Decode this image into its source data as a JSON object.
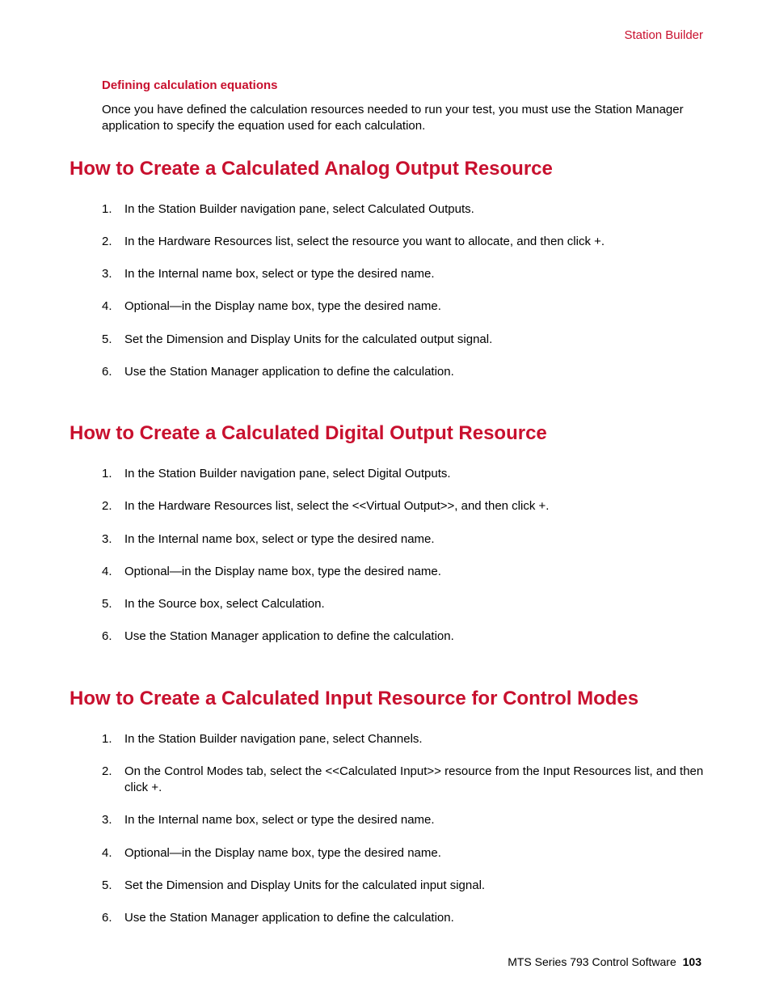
{
  "header": {
    "section_label": "Station Builder"
  },
  "intro": {
    "subheading": "Defining calculation equations",
    "body": "Once you have defined the calculation resources needed to run your test, you must use the Station Manager application to specify the equation used for each calculation."
  },
  "sections": [
    {
      "title": "How to Create a Calculated Analog Output Resource",
      "steps": [
        "In the Station Builder navigation pane, select Calculated Outputs.",
        "In the Hardware Resources list, select the resource you want to allocate, and then click +.",
        "In the Internal name box, select or type the desired name.",
        "Optional—in the Display name box, type the desired name.",
        "Set the Dimension and Display Units for the calculated output signal.",
        "Use the Station Manager application to define the calculation."
      ]
    },
    {
      "title": "How to Create a Calculated Digital Output Resource",
      "steps": [
        "In the Station Builder navigation pane, select Digital Outputs.",
        "In the Hardware Resources list, select the <<Virtual Output>>, and then click +.",
        "In the Internal name box, select or type the desired name.",
        "Optional—in the Display name box, type the desired name.",
        "In the Source box, select Calculation.",
        "Use the Station Manager application to define the calculation."
      ]
    },
    {
      "title": "How to Create a Calculated Input Resource for Control Modes",
      "steps": [
        "In the Station Builder navigation pane, select Channels.",
        "On the Control Modes tab, select the <<Calculated Input>> resource from the Input Resources list, and then click +.",
        "In the Internal name box, select or type the desired name.",
        "Optional—in the Display name box, type the desired name.",
        "Set the Dimension and Display Units for the calculated input signal.",
        "Use the Station Manager application to define the calculation."
      ]
    }
  ],
  "footer": {
    "doc_title": "MTS Series 793 Control Software",
    "page_number": "103"
  }
}
